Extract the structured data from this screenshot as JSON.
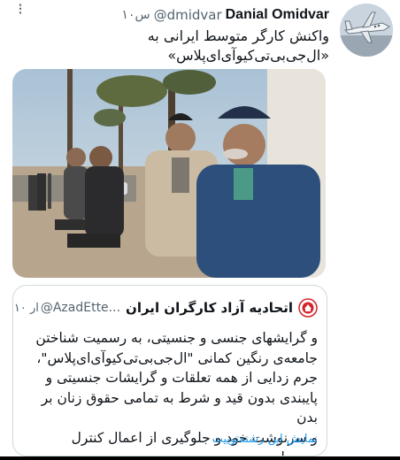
{
  "author": {
    "name": "Danial Omidvar",
    "handle": "@dmidvar",
    "time": "۱۰س",
    "avatar_icon": "airplane-avatar"
  },
  "tweet": {
    "text_line1": "واکنش کارگر متوسط ایرانی به",
    "text_line2": "«ال‌جی‌بی‌تی‌کیوآی‌ای‌پلاس»",
    "photo_desc_icon": "workers-photo"
  },
  "quoted": {
    "name": "اتحادیه آزاد کارگران ایران",
    "handle": "@AzadEtte...",
    "time": "۱۰ ار",
    "lines": [
      "و گرایشهای جنسی و جنسیتی، به رسمیت شناختن",
      "جامعه‌ی رنگین کمانی \"ال‌جی‌بی‌تی‌کیوآی‌ای‌پلاس\"،",
      "جرم زدایی از همه تعلقات و گرایشات جنسیتی و",
      "پایبندی بدون قید و شرط به تمامی حقوق زنان بر بدن",
      "و سرنوشت خود و جلوگیری از اعمال کنترل مردسا..."
    ],
    "show_thread": "نمایش این رشته‌توییت"
  },
  "colors": {
    "link": "#1d9bf0",
    "muted": "#536471",
    "border": "#cfd9de"
  }
}
